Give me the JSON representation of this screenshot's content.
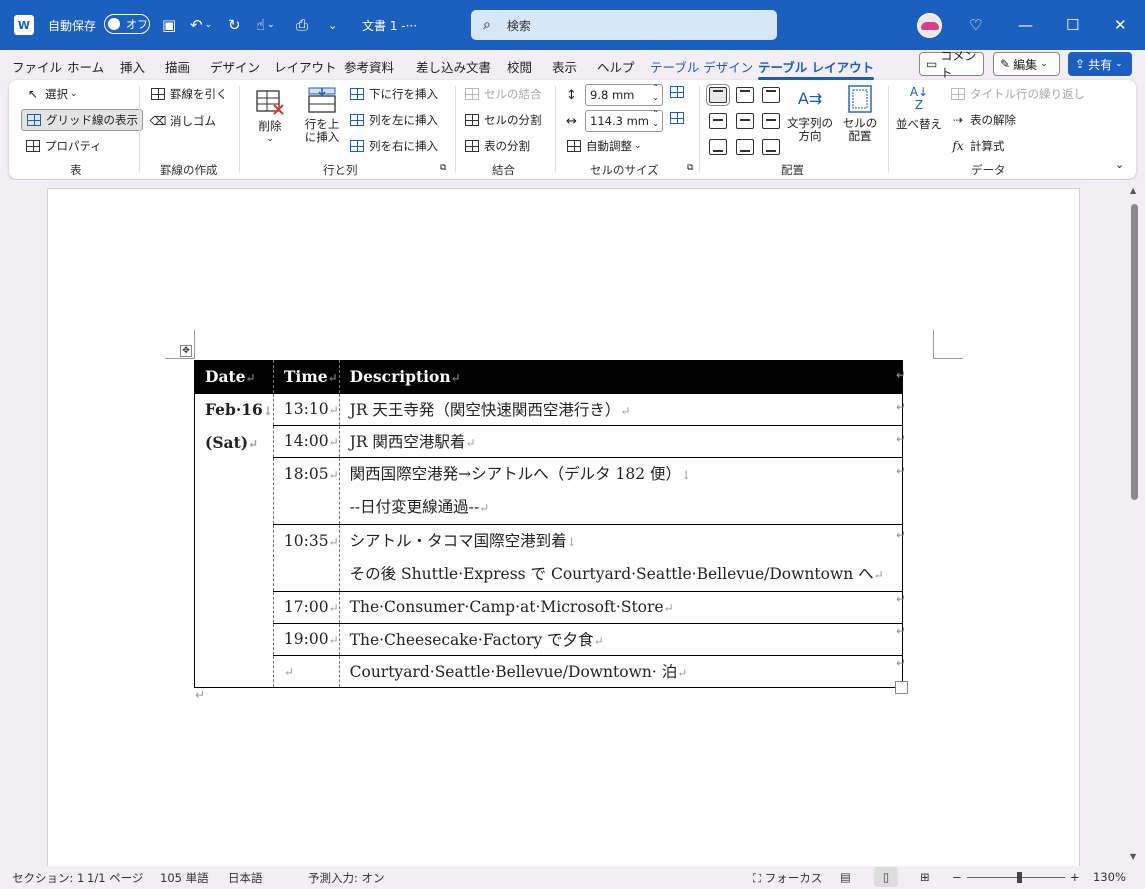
{
  "titlebar": {
    "app_logo": "W",
    "autosave_label": "自動保存",
    "autosave_state": "オフ",
    "doc_name": "文書 1  -···",
    "search_placeholder": "検索"
  },
  "tabs": [
    "ファイル",
    "ホーム",
    "挿入",
    "描画",
    "デザイン",
    "レイアウト",
    "参考資料",
    "差し込み文書",
    "校閲",
    "表示",
    "ヘルプ",
    "テーブル デザイン",
    "テーブル レイアウト"
  ],
  "actions": {
    "comment": "コメント",
    "edit": "編集",
    "share": "共有"
  },
  "ribbon": {
    "table_group": {
      "label": "表",
      "select": "選択",
      "show_grid": "グリッド線の表示",
      "properties": "プロパティ"
    },
    "draw_group": {
      "label": "罫線の作成",
      "draw": "罫線を引く",
      "eraser": "消しゴム"
    },
    "rows_group": {
      "label": "行と列",
      "delete": "削除",
      "insert_above": "行を上\nに挿入",
      "insert_below": "下に行を挿入",
      "insert_left": "列を左に挿入",
      "insert_right": "列を右に挿入"
    },
    "merge_group": {
      "label": "結合",
      "merge": "セルの結合",
      "split_cells": "セルの分割",
      "split_table": "表の分割"
    },
    "size_group": {
      "label": "セルのサイズ",
      "height": "9.8 mm",
      "width": "114.3 mm",
      "autofit": "自動調整"
    },
    "align_group": {
      "label": "配置",
      "direction": "文字列の\n方向",
      "margins": "セルの\n配置"
    },
    "data_group": {
      "label": "データ",
      "sort": "並べ替え",
      "repeat_header": "タイトル行の繰り返し",
      "convert": "表の解除",
      "formula": "計算式"
    }
  },
  "table": {
    "headers": [
      "Date",
      "Time",
      "Description"
    ],
    "date_lines": [
      "Feb·16",
      "(Sat)"
    ],
    "rows": [
      {
        "time": "13:10",
        "desc": [
          "JR 天王寺発（関空快速関西空港行き）"
        ]
      },
      {
        "time": "14:00",
        "desc": [
          "JR 関西空港駅着"
        ]
      },
      {
        "time": "18:05",
        "desc": [
          "関西国際空港発→シアトルへ（デルタ 182 便）",
          "--日付変更線通過--"
        ]
      },
      {
        "time": "10:35",
        "desc": [
          "シアトル・タコマ国際空港到着",
          "その後 Shuttle·Express で Courtyard·Seattle·Bellevue/Downtown へ"
        ]
      },
      {
        "time": "17:00",
        "desc": [
          "The·Consumer·Camp·at·Microsoft·Store"
        ]
      },
      {
        "time": "19:00",
        "desc": [
          "The·Cheesecake·Factory で夕食"
        ]
      },
      {
        "time": "",
        "desc": [
          "Courtyard·Seattle·Bellevue/Downtown· 泊"
        ]
      }
    ]
  },
  "status": {
    "section": "セクション: 1",
    "page": "1/1 ページ",
    "words": "105 単語",
    "language": "日本語",
    "predictive": "予測入力: オン",
    "focus": "フォーカス",
    "zoom": "130%"
  }
}
